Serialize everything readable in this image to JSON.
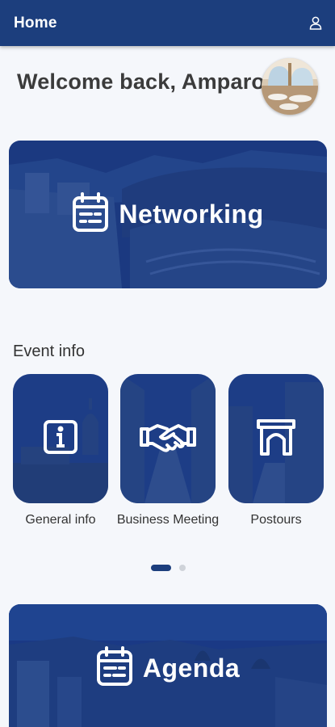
{
  "header": {
    "title": "Home",
    "user_icon": "user-icon"
  },
  "welcome": {
    "text": "Welcome back, Amparo"
  },
  "tiles": {
    "networking": {
      "label": "Networking",
      "icon": "calendar-icon"
    },
    "agenda": {
      "label": "Agenda",
      "icon": "calendar-icon"
    }
  },
  "event_info": {
    "title": "Event info",
    "cards": [
      {
        "label": "General info",
        "icon": "info-icon"
      },
      {
        "label": "Business Meeting",
        "icon": "handshake-icon"
      },
      {
        "label": "Postours",
        "icon": "arch-icon"
      }
    ]
  },
  "carousel": {
    "pages": 2,
    "active": 1
  },
  "colors": {
    "primary": "#1c3e7d",
    "tile_overlay": "#1a3a8a"
  }
}
